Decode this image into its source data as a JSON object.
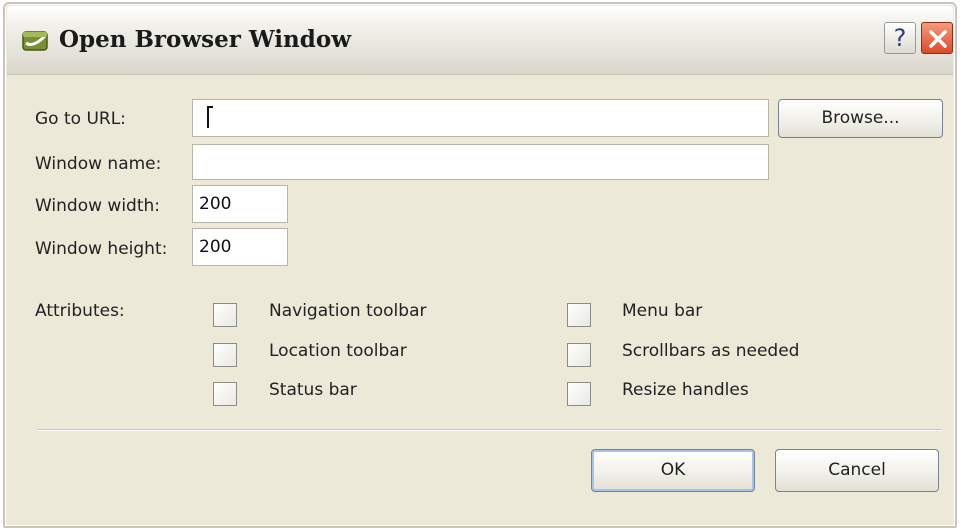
{
  "window": {
    "title": "Open Browser Window",
    "help_label": "?"
  },
  "form": {
    "url": {
      "label": "Go to URL:",
      "value": ""
    },
    "browse_label": "Browse...",
    "window_name": {
      "label": "Window name:",
      "value": ""
    },
    "window_width": {
      "label": "Window width:",
      "value": "200"
    },
    "window_height": {
      "label": "Window height:",
      "value": "200"
    }
  },
  "attributes": {
    "label": "Attributes:",
    "options": [
      {
        "label": "Navigation toolbar",
        "checked": false
      },
      {
        "label": "Location toolbar",
        "checked": false
      },
      {
        "label": "Status bar",
        "checked": false
      },
      {
        "label": "Menu bar",
        "checked": false
      },
      {
        "label": "Scrollbars as needed",
        "checked": false
      },
      {
        "label": "Resize handles",
        "checked": false
      }
    ]
  },
  "actions": {
    "ok_label": "OK",
    "cancel_label": "Cancel"
  },
  "colors": {
    "dialog_bg": "#ece9d8",
    "close_red": "#d94b2a",
    "default_button_focus": "#a9c2e8"
  }
}
